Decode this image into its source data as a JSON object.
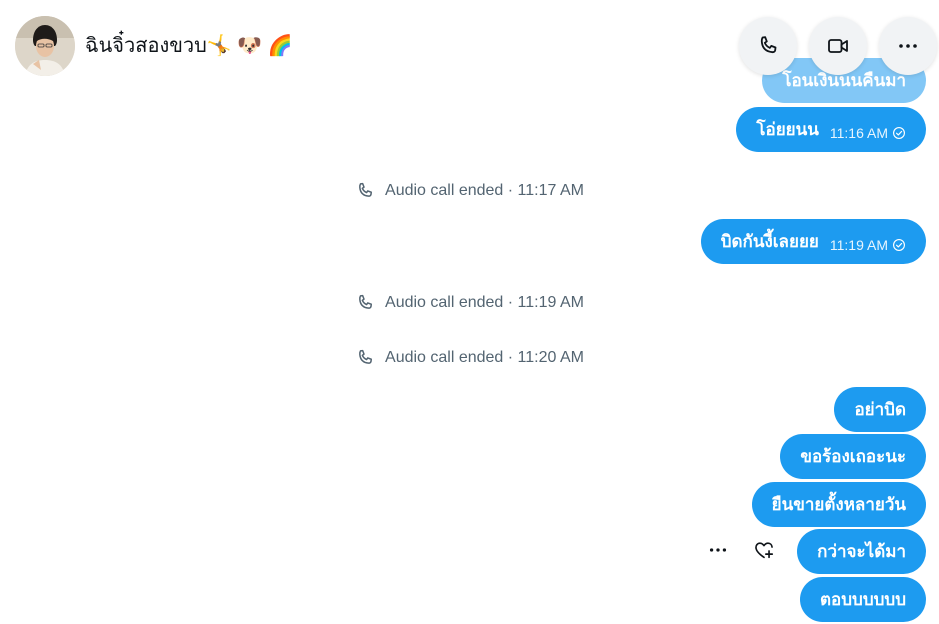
{
  "header": {
    "contact_name": "ฉินจิ๋วสองขวบ🤸 🐶 🌈",
    "actions": [
      {
        "icon": "phone-icon",
        "label": "Audio call"
      },
      {
        "icon": "video-icon",
        "label": "Video call"
      },
      {
        "icon": "more-icon",
        "label": "More options"
      }
    ]
  },
  "messages": {
    "m0": {
      "text": "โอนเงินนนคืนมา"
    },
    "m1": {
      "text": "โอ่ยยนน",
      "time": "11:16 AM"
    },
    "c1": {
      "text": "Audio call ended · 11:17 AM"
    },
    "m2": {
      "text": "บิดกันงี้เลยยย",
      "time": "11:19 AM"
    },
    "c2": {
      "text": "Audio call ended · 11:19 AM"
    },
    "c3": {
      "text": "Audio call ended · 11:20 AM"
    },
    "m3": {
      "text": "อย่าบิด"
    },
    "m4": {
      "text": "ขอร้องเถอะนะ"
    },
    "m5": {
      "text": "ยืนขายตั้งหลายวัน"
    },
    "m6": {
      "text": "กว่าจะได้มา"
    },
    "m7": {
      "text": "ตอบบบบบบ"
    }
  },
  "message_actions": {
    "more_icon": "more-icon",
    "react_icon": "heart-add-icon"
  },
  "colors": {
    "bubble": "#1d9bf0",
    "meta_text": "#536471"
  }
}
